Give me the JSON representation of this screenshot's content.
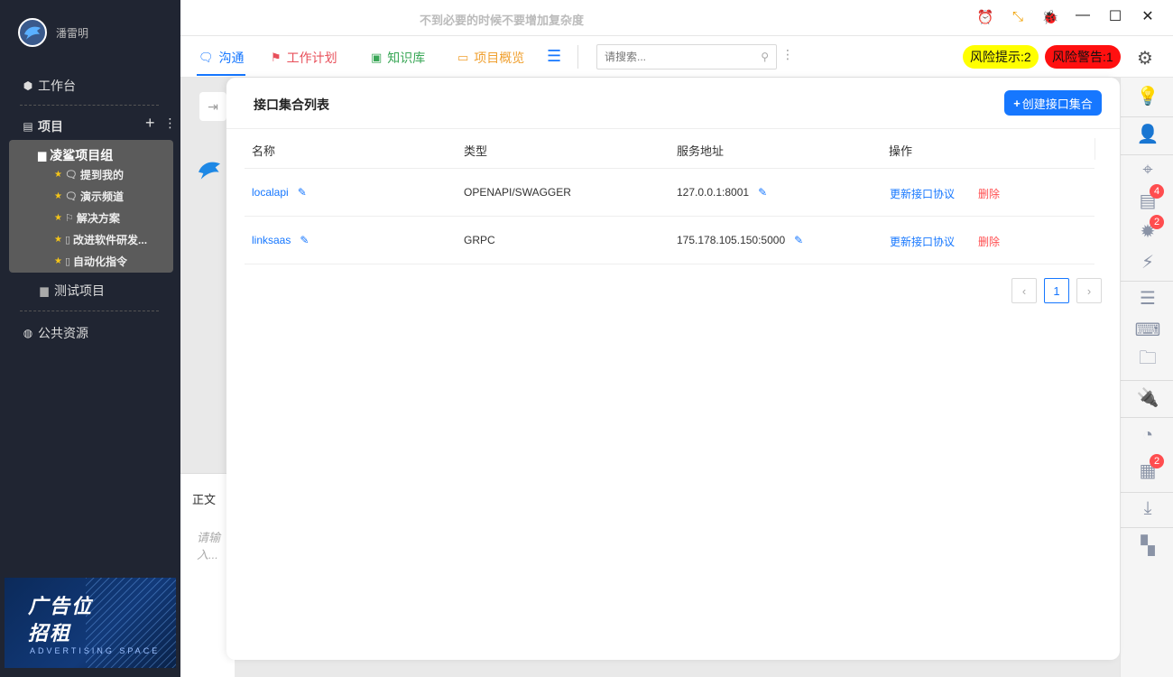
{
  "window": {
    "motto": "不到必要的时候不要增加复杂度"
  },
  "user": {
    "name": "潘雷明"
  },
  "sidebar": {
    "workbench": "工作台",
    "projects_label": "项目",
    "group": {
      "title": "凌鲨项目组",
      "items": [
        {
          "label": "提到我的",
          "icon": "chat-icon"
        },
        {
          "label": "演示频道",
          "icon": "chat-icon"
        },
        {
          "label": "解决方案",
          "icon": "flag-icon"
        },
        {
          "label": "改进软件研发...",
          "icon": "doc-icon"
        },
        {
          "label": "自动化指令",
          "icon": "doc-icon"
        }
      ]
    },
    "test_project": "测试项目",
    "public_resources": "公共资源"
  },
  "ad": {
    "line1": "广告位",
    "line2": "招租",
    "sub": "ADVERTISING SPACE"
  },
  "tabs": [
    {
      "label": "沟通",
      "color": "#1677ff"
    },
    {
      "label": "工作计划",
      "color": "#e8505b"
    },
    {
      "label": "知识库",
      "color": "#3aa757"
    },
    {
      "label": "项目概览",
      "color": "#f0a030"
    }
  ],
  "search": {
    "placeholder": "请搜索..."
  },
  "risk": {
    "hint": "风险提示:2",
    "warning": "风险警告:1",
    "hint_color": "#ffff00",
    "warning_color": "#ff1010"
  },
  "right_badges": {
    "docs": "4",
    "bugs": "2",
    "events": "2"
  },
  "workspace": {
    "editor_tab": "正文",
    "editor_placeholder": "请输入..."
  },
  "panel": {
    "title": "接口集合列表",
    "create_button": "创建接口集合",
    "columns": [
      "名称",
      "类型",
      "服务地址",
      "操作"
    ],
    "rows": [
      {
        "name": "localapi",
        "type": "OPENAPI/SWAGGER",
        "address": "127.0.0.1:8001",
        "update": "更新接口协议",
        "delete": "删除"
      },
      {
        "name": "linksaas",
        "type": "GRPC",
        "address": "175.178.105.150:5000",
        "update": "更新接口协议",
        "delete": "删除"
      }
    ],
    "pagination": {
      "current_page": "1"
    }
  }
}
